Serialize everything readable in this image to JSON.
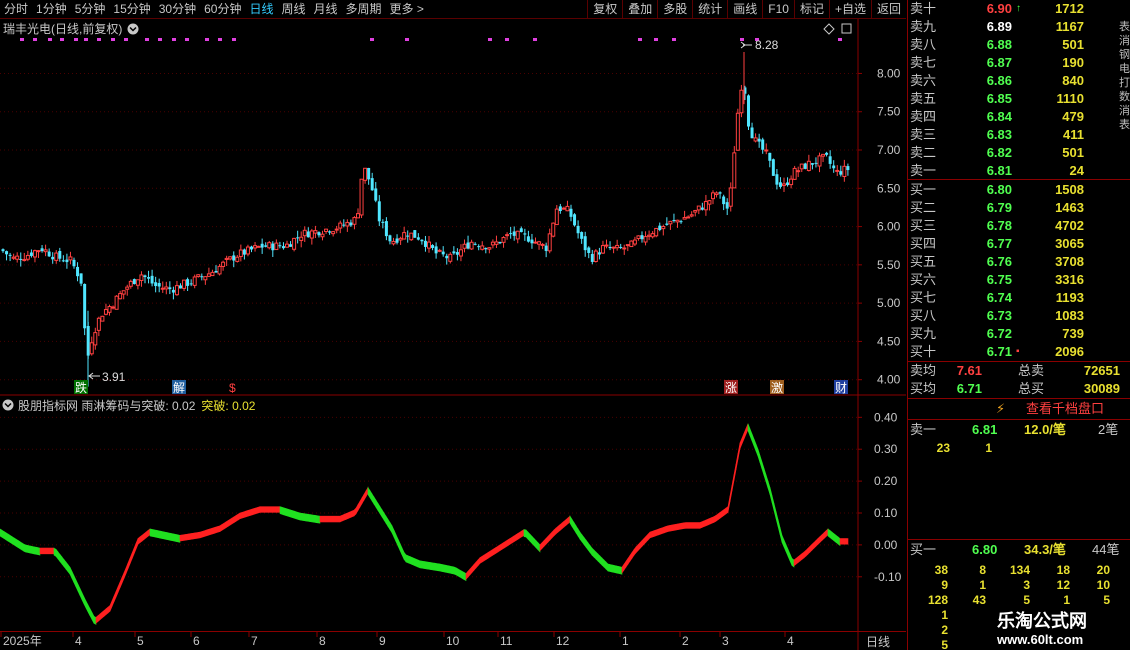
{
  "toolbar": {
    "tabs": [
      "分时",
      "1分钟",
      "5分钟",
      "15分钟",
      "30分钟",
      "60分钟",
      "日线",
      "周线",
      "月线",
      "多周期",
      "更多"
    ],
    "active_tab": "日线",
    "more_arrow": ">",
    "buttons": [
      "复权",
      "叠加",
      "多股",
      "统计",
      "画线",
      "F10",
      "标记",
      "+自选",
      "返回"
    ]
  },
  "main_chart": {
    "title": "瑞丰光电(日线,前复权)",
    "title_icon": "chevron-down-icon",
    "diamond_icon": "diamond-icon",
    "square_icon": "square-icon",
    "y_ticks": [
      "8.00",
      "7.50",
      "7.00",
      "6.50",
      "6.00",
      "5.50",
      "5.00",
      "4.50",
      "4.00"
    ],
    "high_label": "8.28",
    "low_label": "3.91",
    "event_markers": [
      {
        "text": "跌",
        "color": "#ffffff",
        "bg": "#006f00"
      },
      {
        "text": "解",
        "color": "#ffffff",
        "bg": "#1f5f9f"
      },
      {
        "text": "$",
        "color": "#ff4040",
        "bg": "#000000"
      },
      {
        "text": "涨",
        "color": "#ffffff",
        "bg": "#9f1f1f"
      },
      {
        "text": "激",
        "color": "#ffffff",
        "bg": "#9f5f1f"
      },
      {
        "text": "财",
        "color": "#ffffff",
        "bg": "#1f3f9f"
      }
    ],
    "colors": {
      "up": "#ff4040",
      "down": "#50e6ff",
      "grid": "#5a0000",
      "axis": "#8a0000"
    }
  },
  "indicator": {
    "name": "股朋指标网 雨淋筹码与突破",
    "value1_label": "0.02",
    "value2_name": "突破",
    "value2_label": "0.02",
    "y_ticks": [
      "0.40",
      "0.30",
      "0.20",
      "0.10",
      "0.00",
      "-0.10"
    ]
  },
  "date_axis": {
    "labels": [
      "2025年",
      "4",
      "5",
      "6",
      "7",
      "8",
      "9",
      "10",
      "11",
      "12",
      "1",
      "2",
      "3",
      "4"
    ],
    "period": "日线"
  },
  "order_book": {
    "sells": [
      {
        "label": "卖十",
        "price": "6.90",
        "vol": "1712",
        "mark": "up-arrow",
        "color": "#ff4040"
      },
      {
        "label": "卖九",
        "price": "6.89",
        "vol": "1167",
        "color": "#ffffff"
      },
      {
        "label": "卖八",
        "price": "6.88",
        "vol": "501",
        "color": "#50ff50"
      },
      {
        "label": "卖七",
        "price": "6.87",
        "vol": "190",
        "color": "#50ff50"
      },
      {
        "label": "卖六",
        "price": "6.86",
        "vol": "840",
        "color": "#50ff50"
      },
      {
        "label": "卖五",
        "price": "6.85",
        "vol": "1110",
        "color": "#50ff50"
      },
      {
        "label": "卖四",
        "price": "6.84",
        "vol": "479",
        "color": "#50ff50"
      },
      {
        "label": "卖三",
        "price": "6.83",
        "vol": "411",
        "color": "#50ff50"
      },
      {
        "label": "卖二",
        "price": "6.82",
        "vol": "501",
        "color": "#50ff50"
      },
      {
        "label": "卖一",
        "price": "6.81",
        "vol": "24",
        "color": "#50ff50"
      }
    ],
    "buys": [
      {
        "label": "买一",
        "price": "6.80",
        "vol": "1508",
        "color": "#50ff50"
      },
      {
        "label": "买二",
        "price": "6.79",
        "vol": "1463",
        "color": "#50ff50"
      },
      {
        "label": "买三",
        "price": "6.78",
        "vol": "4702",
        "color": "#50ff50"
      },
      {
        "label": "买四",
        "price": "6.77",
        "vol": "3065",
        "color": "#50ff50"
      },
      {
        "label": "买五",
        "price": "6.76",
        "vol": "3708",
        "color": "#50ff50"
      },
      {
        "label": "买六",
        "price": "6.75",
        "vol": "3316",
        "color": "#50ff50"
      },
      {
        "label": "买七",
        "price": "6.74",
        "vol": "1193",
        "color": "#50ff50"
      },
      {
        "label": "买八",
        "price": "6.73",
        "vol": "1083",
        "color": "#50ff50"
      },
      {
        "label": "买九",
        "price": "6.72",
        "vol": "739",
        "color": "#50ff50"
      },
      {
        "label": "买十",
        "price": "6.71",
        "vol": "2096",
        "mark": "down-dot",
        "color": "#50ff50"
      }
    ],
    "avg_sell_label": "卖均",
    "avg_sell_price": "7.61",
    "total_sell_label": "总卖",
    "total_sell_vol": "72651",
    "avg_buy_label": "买均",
    "avg_buy_price": "6.71",
    "total_buy_label": "总买",
    "total_buy_vol": "30089"
  },
  "depth": {
    "icon": "lightning-icon",
    "link": "查看千档盘口",
    "sell1": {
      "label": "卖一",
      "price": "6.81",
      "per": "12.0/笔",
      "count": "2笔"
    },
    "sell1_queue": [
      "23",
      "1"
    ],
    "buy1": {
      "label": "买一",
      "price": "6.80",
      "per": "34.3/笔",
      "count": "44笔"
    },
    "buy1_queue": [
      [
        "38",
        "8",
        "134",
        "18",
        "20"
      ],
      [
        "9",
        "1",
        "3",
        "12",
        "10"
      ],
      [
        "128",
        "43",
        "5",
        "1",
        "5"
      ],
      [
        "1",
        "",
        "",
        "",
        ""
      ],
      [
        "2",
        "",
        "",
        "",
        ""
      ],
      [
        "5",
        "",
        "",
        "",
        ""
      ]
    ]
  },
  "side_strip": "表消钢电打数消表",
  "watermark": {
    "site_name": "乐淘公式网",
    "url": "www.60lt.com"
  }
}
